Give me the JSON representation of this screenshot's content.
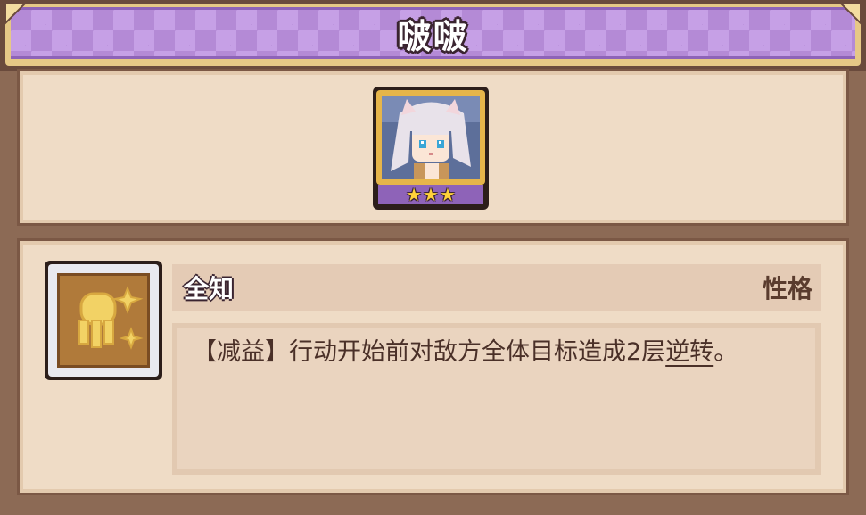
{
  "header": {
    "title": "啵啵"
  },
  "character": {
    "portrait_icon": "character-portrait-icon",
    "star_count": 3,
    "star_color": "#ffd23a"
  },
  "skill": {
    "icon": "skill-crest-icon",
    "name": "全知",
    "type": "性格",
    "description_prefix": "【减益】行动开始前对敌方全体目标造成2层",
    "keyword": "逆转",
    "description_suffix": "。"
  },
  "colors": {
    "banner_purple": "#b48ad6",
    "panel_bg": "#efdcc6",
    "frame_brown": "#8c6a55"
  }
}
